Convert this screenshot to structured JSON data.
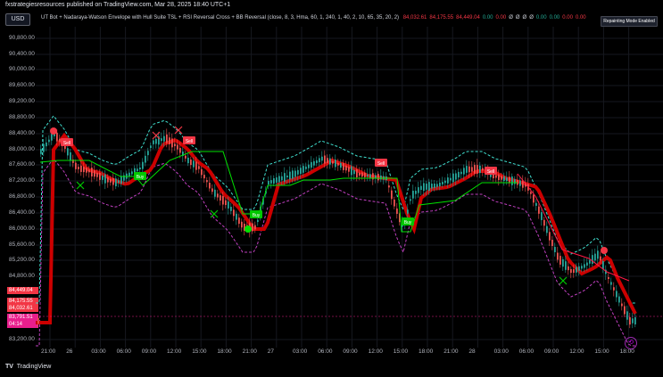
{
  "header": {
    "published_text": "fxstrategiesresources published on TradingView.com, Mar 28, 2025 18:40 UTC+1"
  },
  "toolbar": {
    "currency": "USD"
  },
  "indicator": {
    "label": "UT Bot + Nadaraya-Watson Envelope with Hull Suite TSL + RSI Reversal Cross + BB Reversal (close, 8, 3, Hma, 60, 1, 240, 1, 40, 2, 10, 65, 35, 20, 2)",
    "values": [
      {
        "text": "84,032.61",
        "color": "#f23645"
      },
      {
        "text": "84,175.55",
        "color": "#f23645"
      },
      {
        "text": "84,449.04",
        "color": "#f23645"
      },
      {
        "text": "0.00",
        "color": "#22ab94"
      },
      {
        "text": "0.00",
        "color": "#f23645"
      },
      {
        "text": "Ø",
        "color": "#d1d4dc"
      },
      {
        "text": "Ø",
        "color": "#d1d4dc"
      },
      {
        "text": "Ø",
        "color": "#d1d4dc"
      },
      {
        "text": "Ø",
        "color": "#d1d4dc"
      },
      {
        "text": "0.00",
        "color": "#22ab94"
      },
      {
        "text": "0.00",
        "color": "#22ab94"
      },
      {
        "text": "0.00",
        "color": "#f23645"
      },
      {
        "text": "0.00",
        "color": "#f23645"
      }
    ]
  },
  "repaint_badge": "Repainting Mode Enabled",
  "price_axis": {
    "labels": [
      "90,800.00",
      "90,400.00",
      "90,000.00",
      "89,600.00",
      "89,200.00",
      "88,800.00",
      "88,400.00",
      "88,000.00",
      "87,600.00",
      "87,200.00",
      "86,800.00",
      "86,400.00",
      "86,000.00",
      "85,600.00",
      "85,200.00",
      "84,800.00",
      "83,200.00"
    ],
    "tags": [
      {
        "text": "84,449.04",
        "bg": "#f23645"
      },
      {
        "text": "84,175.55",
        "bg": "#f23645"
      },
      {
        "text": "84,032.61",
        "bg": "#f23645"
      },
      {
        "text": "83,791.51",
        "bg": "#e91e8c"
      },
      {
        "text": "04:14",
        "bg": "#e91e8c"
      }
    ]
  },
  "time_axis": [
    "21:00",
    "26",
    "03:00",
    "06:00",
    "09:00",
    "12:00",
    "15:00",
    "18:00",
    "21:00",
    "27",
    "03:00",
    "06:00",
    "09:00",
    "12:00",
    "15:00",
    "18:00",
    "21:00",
    "28",
    "03:00",
    "06:00",
    "09:00",
    "12:00",
    "15:00",
    "18:00"
  ],
  "signals": [
    "Sell",
    "Buy",
    "Sell",
    "Buy",
    "Sell",
    "Buy",
    "Sell"
  ],
  "brand": "TradingView",
  "colors": {
    "bull_candle": "#26a69a",
    "bear_candle": "#ef5350",
    "hull_bear": "#cc0000",
    "hull_bull": "#00c800",
    "envelope_upper": "#40e0d0",
    "envelope_lower": "#c040c0"
  }
}
